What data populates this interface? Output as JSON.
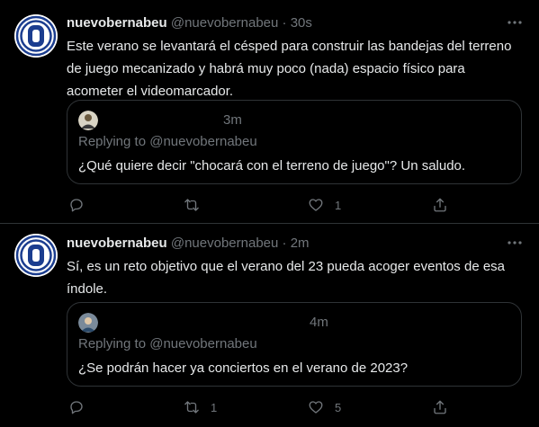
{
  "tweets": [
    {
      "name": "nuevobernabeu",
      "handle": "@nuevobernabeu",
      "separator": "·",
      "time": "30s",
      "text": "Este verano se levantará el césped para construir las bandejas del terreno de juego mecanizado y habrá muy poco (nada) espacio físico para acometer el videomarcador.",
      "quote": {
        "time": "3m",
        "replying_to": "Replying to @nuevobernabeu",
        "text": "¿Qué quiere decir \"chocará con el terreno de juego\"? Un saludo."
      },
      "actions": {
        "reply_count": "",
        "retweet_count": "",
        "like_count": "1"
      }
    },
    {
      "name": "nuevobernabeu",
      "handle": "@nuevobernabeu",
      "separator": "·",
      "time": "2m",
      "text": "Sí, es un reto objetivo que el verano del 23 pueda acoger eventos de esa índole.",
      "quote": {
        "time": "4m",
        "replying_to": "Replying to @nuevobernabeu",
        "text": "¿Se podrán hacer ya conciertos en el verano de 2023?"
      },
      "actions": {
        "reply_count": "",
        "retweet_count": "1",
        "like_count": "5"
      }
    }
  ],
  "icons": {
    "more": "more-horizontal-icon",
    "reply": "reply-icon",
    "retweet": "retweet-icon",
    "like": "heart-icon",
    "share": "share-icon"
  },
  "colors": {
    "background": "#000000",
    "text_primary": "#e7e9ea",
    "text_secondary": "#71767b",
    "border": "#2f3336",
    "avatar_blue": "#1b3d8f"
  }
}
